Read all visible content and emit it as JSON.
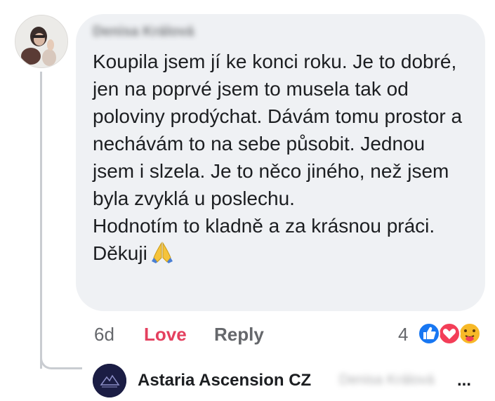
{
  "comment": {
    "author_name": "Denisa Králová",
    "paragraphs": [
      "Koupila jsem jí ke konci roku. Je to dobré, jen na poprvé jsem to musela tak od poloviny prodýchat. Dávám tomu prostor a nechávám to na sebe působit. Jednou jsem i slzela. Je to něco jiného, než jsem byla zvyklá u poslechu.",
      "Hodnotím to kladně a za krásnou práci. Děkuji"
    ],
    "emoji": "folded-hands-icon"
  },
  "actions": {
    "time": "6d",
    "love": "Love",
    "reply": "Reply"
  },
  "reactions": {
    "count": "4",
    "icons": [
      "like-icon",
      "love-icon",
      "care-icon"
    ]
  },
  "reply_preview": {
    "author": "Astaria Ascension CZ",
    "mention": "Denisa Králová",
    "ellipsis": "..."
  },
  "colors": {
    "bubble": "#eff1f4",
    "love": "#e4405f",
    "secondary_text": "#65676b",
    "like_blue": "#1877f2"
  }
}
